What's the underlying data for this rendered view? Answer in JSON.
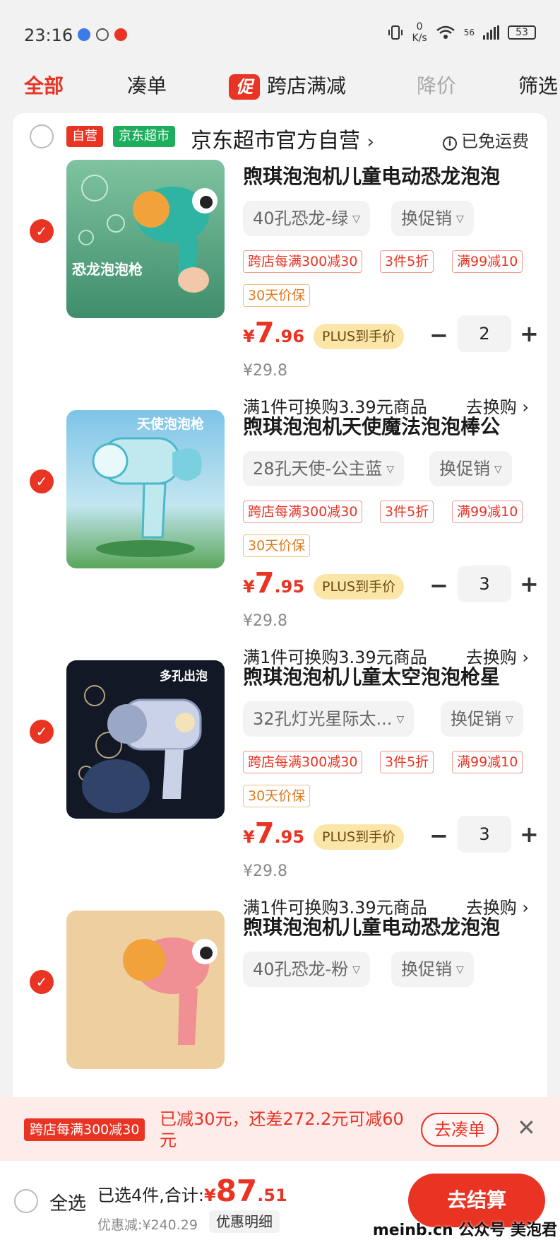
{
  "status_bar": {
    "time": "23:16",
    "net_speed_value": "0",
    "net_speed_unit": "K/s",
    "signal_label": "56",
    "battery": "53"
  },
  "tabs": [
    {
      "label": "全部",
      "active": true
    },
    {
      "label": "凑单"
    },
    {
      "label": "跨店满减",
      "badge": "促"
    },
    {
      "label": "降价"
    },
    {
      "label": "筛选"
    }
  ],
  "store": {
    "self_operated_tag": "自营",
    "supermarket_tag": "京东超市",
    "name": "京东超市官方自营",
    "chevron": "›",
    "free_shipping": "已免运费"
  },
  "items": [
    {
      "title": "煦琪泡泡机儿童电动恐龙泡泡",
      "spec": "40孔恐龙-绿",
      "promo_select": "换促销",
      "tags": [
        "跨店每满300减30",
        "3件5折",
        "满99减10"
      ],
      "guarantee": "30天价保",
      "price_currency": "¥",
      "price_int": "7",
      "price_dec": ".96",
      "plus_label": "PLUS到手价",
      "qty": "2",
      "orig_price": "¥29.8",
      "swap_text": "满1件可换购3.39元商品",
      "swap_link": "去换购 ›",
      "image_text": "恐龙泡泡枪"
    },
    {
      "title": "煦琪泡泡机天使魔法泡泡棒公",
      "spec": "28孔天使-公主蓝",
      "promo_select": "换促销",
      "tags": [
        "跨店每满300减30",
        "3件5折",
        "满99减10"
      ],
      "guarantee": "30天价保",
      "price_currency": "¥",
      "price_int": "7",
      "price_dec": ".95",
      "plus_label": "PLUS到手价",
      "qty": "3",
      "orig_price": "¥29.8",
      "swap_text": "满1件可换购3.39元商品",
      "swap_link": "去换购 ›",
      "image_text": "天使泡泡枪"
    },
    {
      "title": "煦琪泡泡机儿童太空泡泡枪星",
      "spec": "32孔灯光星际太...",
      "promo_select": "换促销",
      "tags": [
        "跨店每满300减30",
        "3件5折",
        "满99减10"
      ],
      "guarantee": "30天价保",
      "price_currency": "¥",
      "price_int": "7",
      "price_dec": ".95",
      "plus_label": "PLUS到手价",
      "qty": "3",
      "orig_price": "¥29.8",
      "swap_text": "满1件可换购3.39元商品",
      "swap_link": "去换购 ›",
      "image_text": "多孔出泡"
    },
    {
      "title": "煦琪泡泡机儿童电动恐龙泡泡",
      "spec": "40孔恐龙-粉",
      "promo_select": "换促销"
    }
  ],
  "promo_bar": {
    "tag": "跨店每满300减30",
    "text": "已减30元，还差272.2元可减60元",
    "button": "去凑单",
    "close": "✕"
  },
  "bottom_bar": {
    "select_all": "全选",
    "summary_prefix": "已选4件,合计:",
    "total_currency": "¥",
    "total_int": "87",
    "total_dec": ".51",
    "discount": "优惠减:¥240.29",
    "detail_button": "优惠明细",
    "checkout": "去结算"
  },
  "watermark": "meinb.cn  公众号 美泡君",
  "colors": {
    "accent": "#e93323",
    "supermarket_green": "#1dae5d",
    "plus_gold": "#fbe6a8"
  }
}
